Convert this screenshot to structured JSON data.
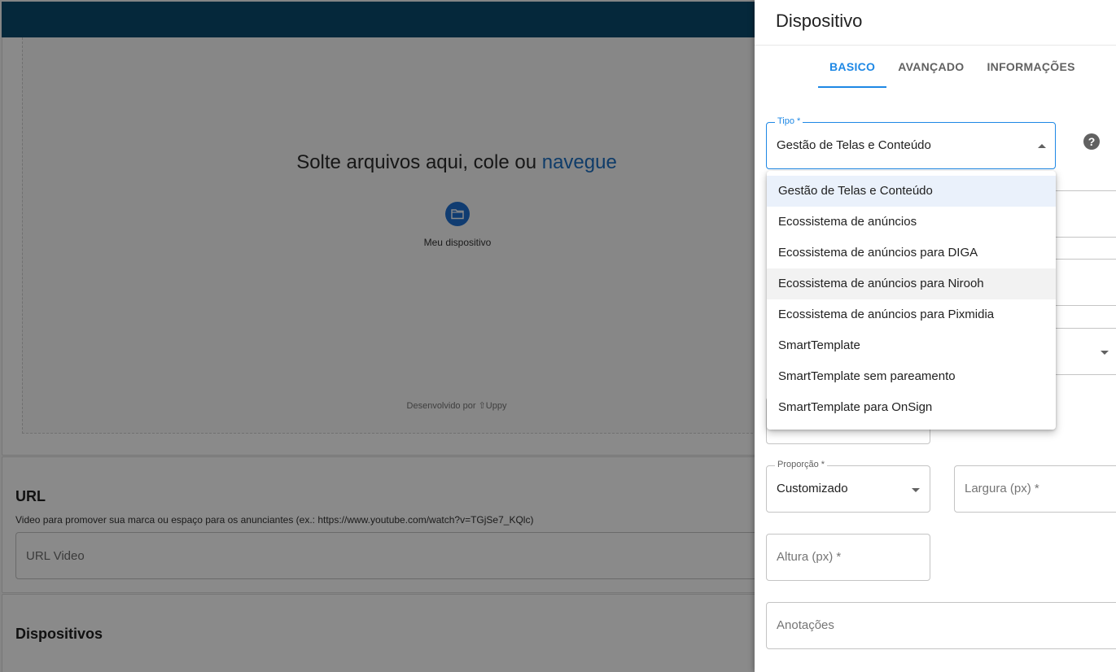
{
  "upload": {
    "drop_text": "Solte arquivos aqui, cole ou ",
    "browse_link": "navegue",
    "source_label": "Meu dispositivo",
    "powered_by": "Desenvolvido por ⇧Uppy"
  },
  "url_section": {
    "title": "URL",
    "description": "Video para promover sua marca ou espaço para os anunciantes (ex.: https://www.youtube.com/watch?v=TGjSe7_KQlc)",
    "placeholder": "URL Video"
  },
  "devices_section": {
    "title": "Dispositivos"
  },
  "drawer": {
    "title": "Dispositivo",
    "tabs": [
      {
        "label": "BASICO",
        "active": true
      },
      {
        "label": "AVANÇADO",
        "active": false
      },
      {
        "label": "INFORMAÇÕES",
        "active": false
      }
    ],
    "tipo": {
      "label": "Tipo *",
      "value": "Gestão de Telas e Conteúdo"
    },
    "help_icon": "?",
    "proporcao": {
      "label": "Proporção *",
      "value": "Customizado"
    },
    "largura_placeholder": "Largura (px) *",
    "altura_placeholder": "Altura (px) *",
    "anotacoes_placeholder": "Anotações"
  },
  "tipo_options": [
    "Gestão de Telas e Conteúdo",
    "Ecossistema de anúncios",
    "Ecossistema de anúncios para DIGA",
    "Ecossistema de anúncios para Nirooh",
    "Ecossistema de anúncios para Pixmidia",
    "SmartTemplate",
    "SmartTemplate sem pareamento",
    "SmartTemplate para OnSign"
  ],
  "colors": {
    "topbar": "#0b4a6e",
    "accent": "#1e88e5",
    "link": "#1d6fc2",
    "overlay": "rgba(0,0,0,0.46)"
  }
}
